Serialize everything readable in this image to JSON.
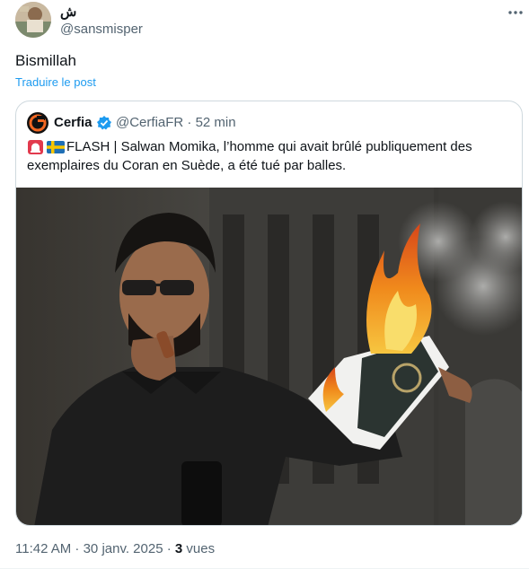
{
  "tweet": {
    "author": {
      "display_name": "ش",
      "handle": "@sansmisper"
    },
    "text": "Bismillah",
    "translate_label": "Traduire le post",
    "timestamp": "11:42 AM · 30 janv. 2025 · ",
    "views_count": "3",
    "views_label": " vues"
  },
  "quoted": {
    "author": {
      "display_name": "Cerfia",
      "handle": "@CerfiaFR",
      "time": "52 min"
    },
    "flags": [
      "siren-icon",
      "sweden-flag-icon"
    ],
    "text": "FLASH | Salwan Momika, l’homme qui avait brûlé publiquement des exemplaires du Coran en Suède, a été tué par balles."
  },
  "colors": {
    "link": "#1d9bf0",
    "verified": "#1d9bf0",
    "muted_text": "#536471",
    "border": "#cfd9de",
    "cerfia_brand": "#f26722"
  }
}
